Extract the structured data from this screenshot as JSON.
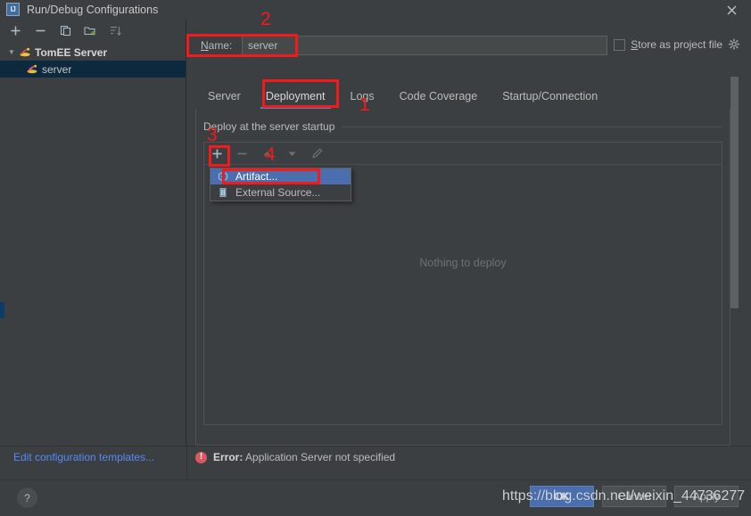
{
  "window": {
    "title": "Run/Debug Configurations",
    "icon_label": "IJ",
    "close_icon": "close-icon"
  },
  "left_panel": {
    "toolbar": [
      {
        "name": "add-configuration-button",
        "glyph": "plus"
      },
      {
        "name": "remove-configuration-button",
        "glyph": "minus"
      },
      {
        "name": "copy-configuration-button",
        "glyph": "copy"
      },
      {
        "name": "save-configuration-button",
        "glyph": "folder-add"
      },
      {
        "name": "sort-configurations-button",
        "glyph": "sort"
      }
    ],
    "tree": [
      {
        "label": "TomEE Server",
        "type": "group",
        "expanded": true,
        "icon": "tomee-icon"
      },
      {
        "label": "server",
        "type": "item",
        "selected": true,
        "icon": "tomee-icon"
      }
    ],
    "edit_templates_link": "Edit configuration templates..."
  },
  "name_field": {
    "label_prefix": "N",
    "label_rest": "ame:",
    "value": "server",
    "placeholder": "Name"
  },
  "store_as_project_file": {
    "label_prefix": "S",
    "label_rest": "tore as project file",
    "checked": false,
    "gear_icon": "gear-icon"
  },
  "tabs": [
    {
      "label": "Server",
      "active": false
    },
    {
      "label": "Deployment",
      "active": true
    },
    {
      "label": "Logs",
      "active": false
    },
    {
      "label": "Code Coverage",
      "active": false
    },
    {
      "label": "Startup/Connection",
      "active": false
    }
  ],
  "deployment": {
    "section_title": "Deploy at the server startup",
    "toolbar": [
      {
        "name": "add-deployment-button",
        "glyph": "plus",
        "enabled": true
      },
      {
        "name": "remove-deployment-button",
        "glyph": "minus",
        "enabled": false
      },
      {
        "name": "move-up-button",
        "glyph": "arrow-up",
        "enabled": false
      },
      {
        "name": "move-down-button",
        "glyph": "arrow-down",
        "enabled": false
      },
      {
        "name": "edit-deployment-button",
        "glyph": "pencil",
        "enabled": false
      }
    ],
    "empty_text": "Nothing to deploy"
  },
  "dropdown": {
    "items": [
      {
        "label": "Artifact...",
        "selected": true,
        "icon": "artifact-icon"
      },
      {
        "label": "External Source...",
        "selected": false,
        "icon": "external-source-icon"
      }
    ]
  },
  "status": {
    "error_prefix": "Error:",
    "error_message": "Application Server not specified",
    "error_icon": "error-icon"
  },
  "bottom_bar": {
    "help_label": "?",
    "buttons": [
      {
        "label": "OK",
        "primary": true
      },
      {
        "label": "Cancel",
        "primary": false
      },
      {
        "label": "Apply",
        "primary": false
      }
    ]
  },
  "watermark": {
    "text": "https://blog.csdn.net/weixin_44736277"
  },
  "annotations": [
    {
      "number": "1",
      "target": "logs-tab-area"
    },
    {
      "number": "2",
      "target": "name-field"
    },
    {
      "number": "3",
      "target": "deploy-section"
    },
    {
      "number": "4",
      "target": "add-deployment-button"
    }
  ],
  "colors": {
    "background": "#3c3f41",
    "accent_blue": "#4b6eaf",
    "tab_underline": "#4a88c7",
    "link": "#548af7",
    "error_red": "#db5860",
    "annotation_red": "#f21a1a",
    "selection_tree": "#0d293e"
  }
}
